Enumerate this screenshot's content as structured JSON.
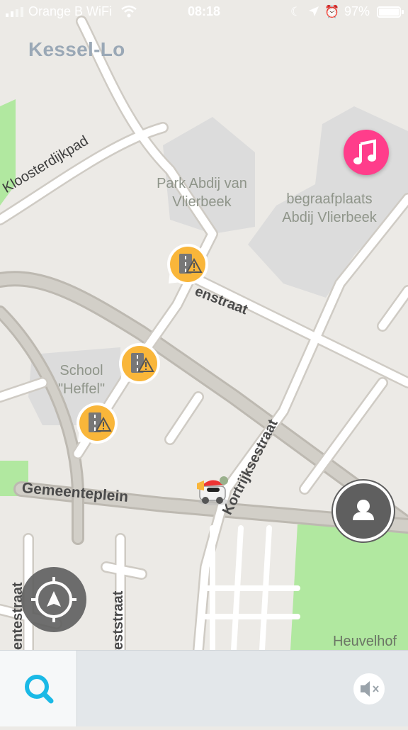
{
  "status_bar": {
    "carrier": "Orange B WiFi",
    "time": "08:18",
    "battery_percent": "97%",
    "icons": [
      "signal-icon",
      "wifi-icon",
      "moon-icon",
      "location-arrow-icon",
      "alarm-icon",
      "battery-icon"
    ]
  },
  "map": {
    "area_name": "Kessel-Lo",
    "places": {
      "park": [
        "Park Abdij van",
        "Vlierbeek"
      ],
      "cemetery": [
        "begraafplaats",
        "Abdij Vlierbeek"
      ],
      "school": [
        "School",
        "\"Heffel\""
      ],
      "corner": "Heuvelhof"
    },
    "roads": {
      "kloosterdijkpad": "Kloosterdijkpad",
      "enstraat": "enstraat",
      "kortrijksestraat": "Kortrijksestraat",
      "gemeenteplein": "Gemeenteplein",
      "entestraat": "entestraat",
      "eststraat": "eststraat"
    },
    "hazard_icon": "road-closed-warning-icon",
    "colors": {
      "background": "#eceae6",
      "road": "#ffffff",
      "road_outline": "#cfcbc4",
      "main_road": "#c9c6bf",
      "park_green": "#b1e8a0",
      "building_gray": "#dcdcdc",
      "hazard_orange": "#f9b63a",
      "music_pink": "#ff3d8b",
      "search_blue": "#1ab9e6"
    }
  },
  "controls": {
    "music_button_icon": "music-note-icon",
    "me_button_icon": "person-icon",
    "recenter_button_icon": "recenter-arrow-icon",
    "search_icon": "search-icon",
    "mute_icon": "speaker-muted-icon"
  }
}
